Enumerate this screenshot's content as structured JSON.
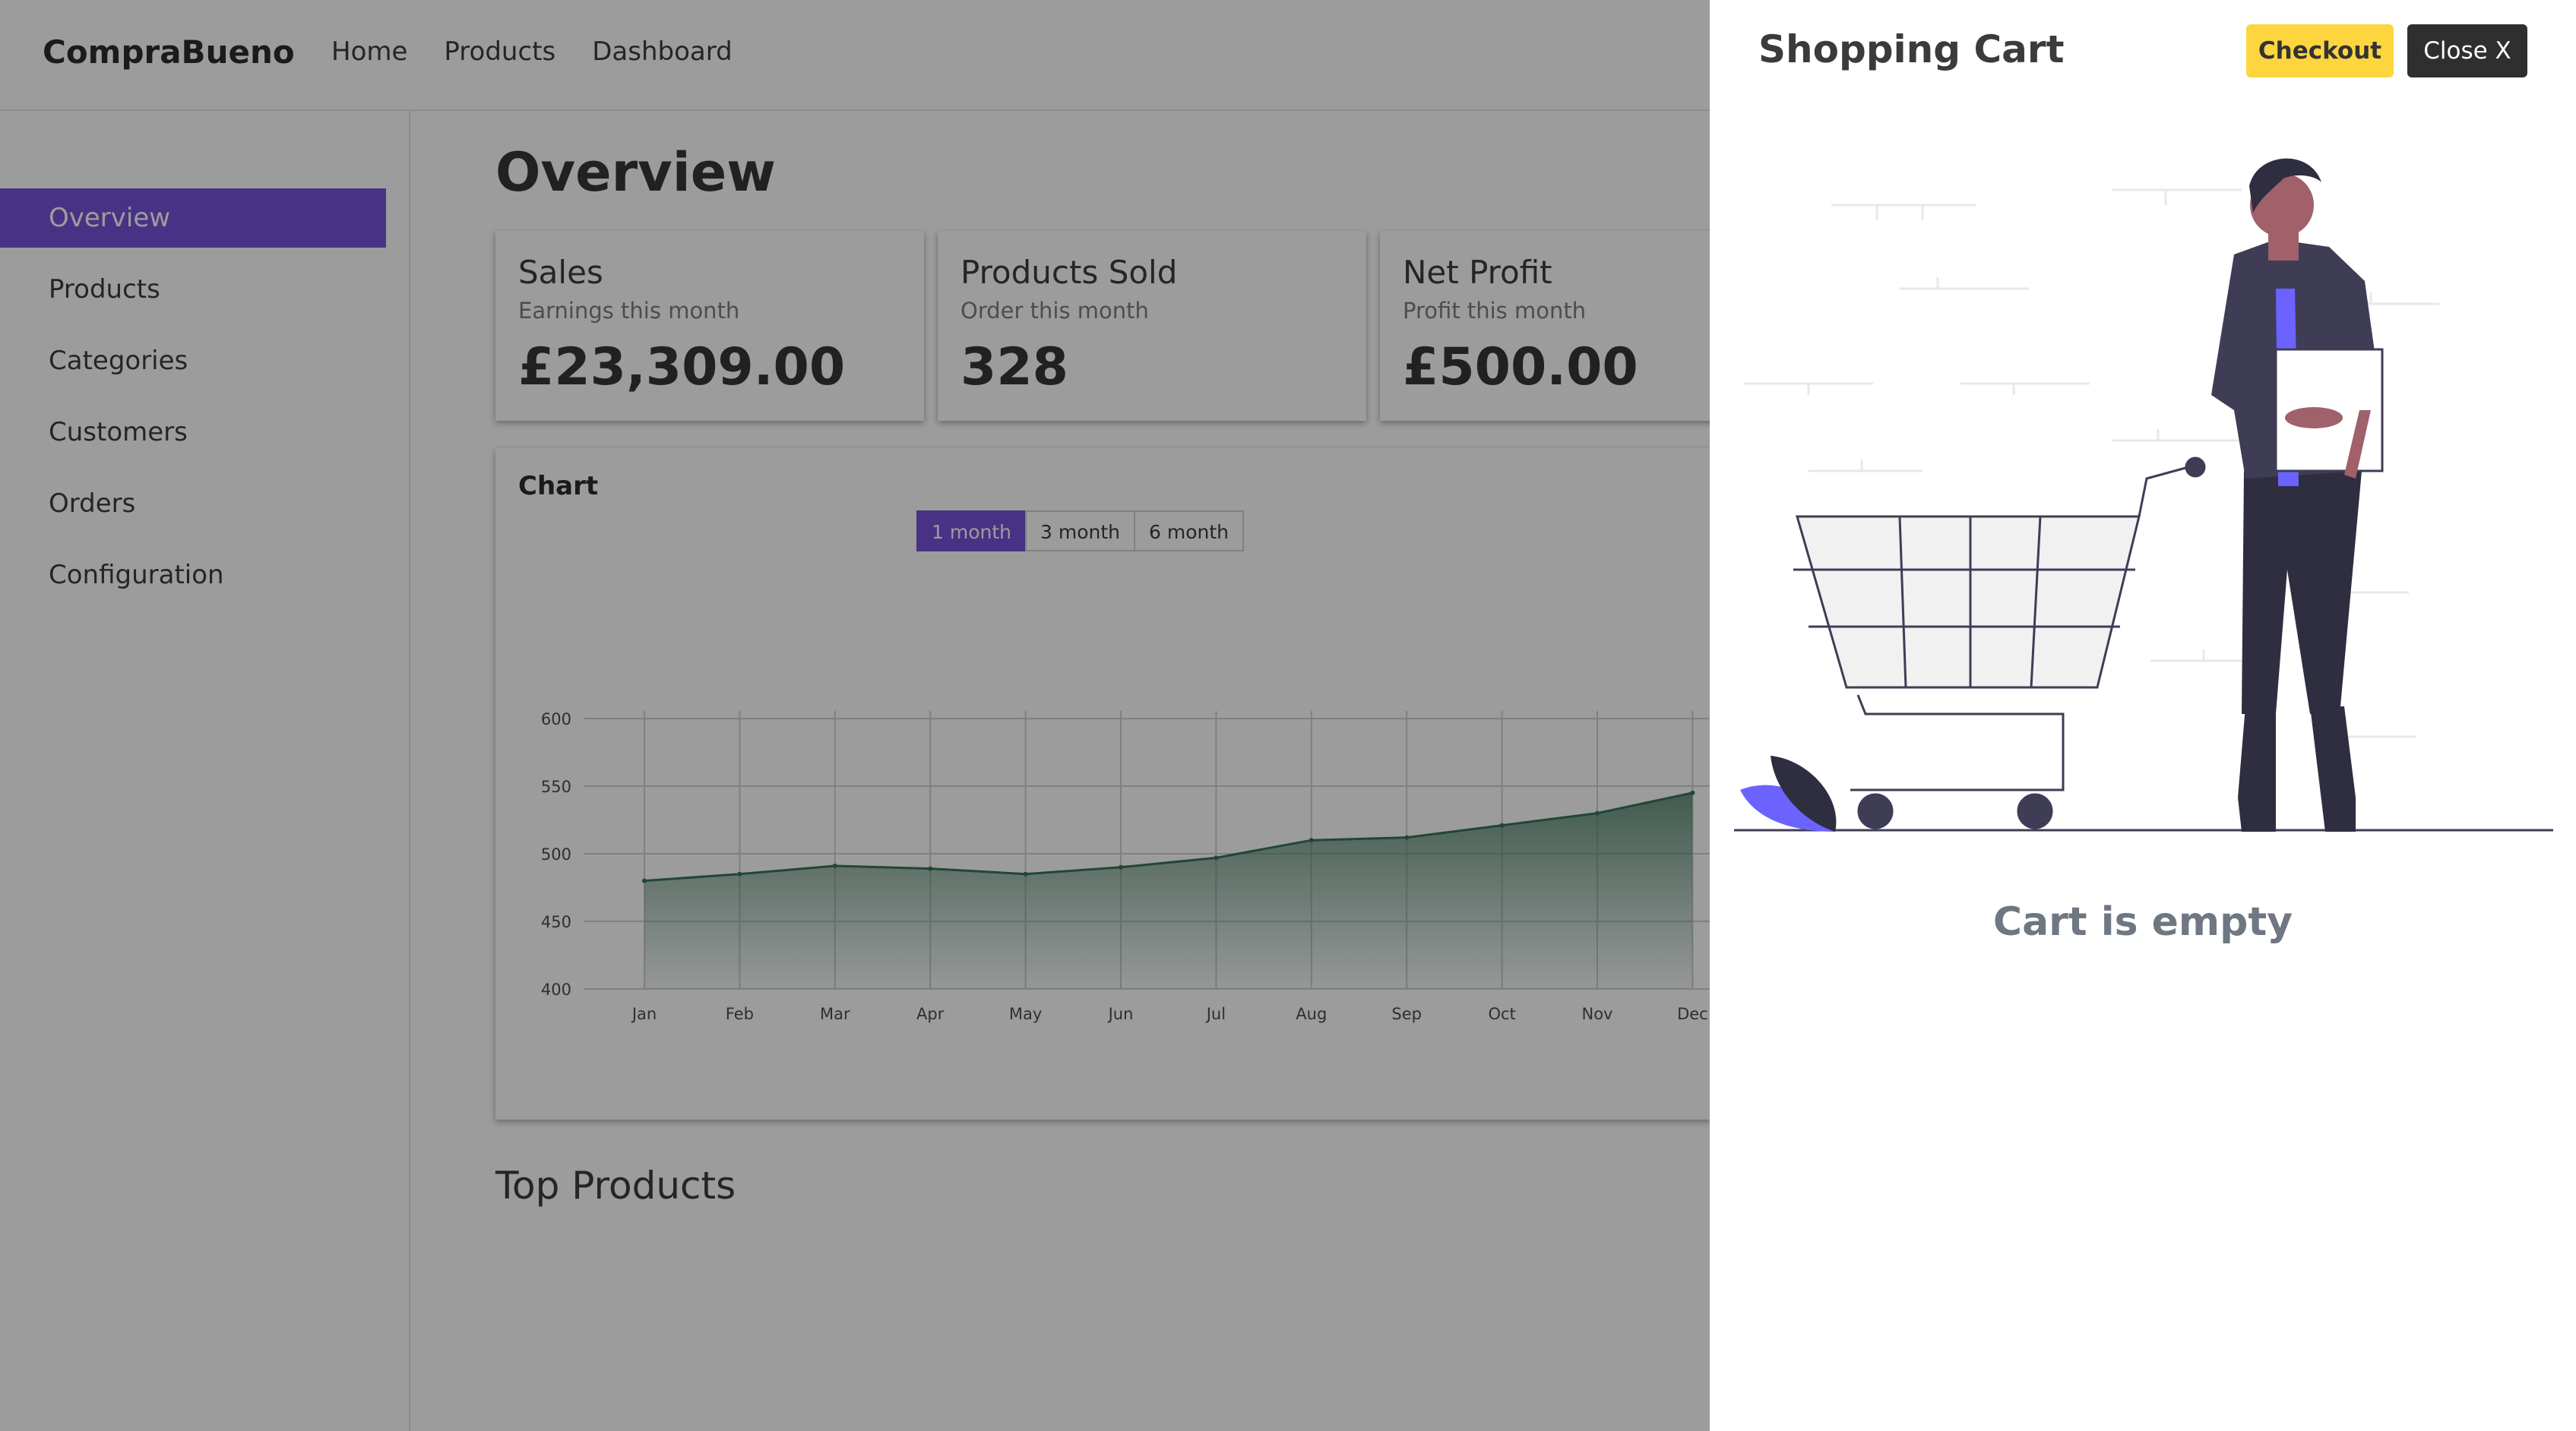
{
  "app": {
    "brand": "CompraBueno",
    "nav": [
      "Home",
      "Products",
      "Dashboard"
    ]
  },
  "sidebar": {
    "items": [
      {
        "label": "Overview",
        "active": true
      },
      {
        "label": "Products",
        "active": false
      },
      {
        "label": "Categories",
        "active": false
      },
      {
        "label": "Customers",
        "active": false
      },
      {
        "label": "Orders",
        "active": false
      },
      {
        "label": "Configuration",
        "active": false
      }
    ]
  },
  "main": {
    "title": "Overview",
    "cards": [
      {
        "title": "Sales",
        "subtitle": "Earnings this month",
        "value": "£23,309.00"
      },
      {
        "title": "Products Sold",
        "subtitle": "Order this month",
        "value": "328"
      },
      {
        "title": "Net Profit",
        "subtitle": "Profit this month",
        "value": "£500.00"
      }
    ],
    "chart_section": {
      "heading": "Chart",
      "ranges": [
        {
          "label": "1 month",
          "active": true
        },
        {
          "label": "3 month",
          "active": false
        },
        {
          "label": "6 month",
          "active": false
        }
      ]
    },
    "top_products_heading": "Top Products"
  },
  "chart_data": {
    "type": "area",
    "title": "",
    "categories": [
      "Jan",
      "Feb",
      "Mar",
      "Apr",
      "May",
      "Jun",
      "Jul",
      "Aug",
      "Sep",
      "Oct",
      "Nov",
      "Dec"
    ],
    "series": [
      {
        "values": [
          480,
          485,
          491,
          489,
          485,
          490,
          497,
          510,
          512,
          521,
          530,
          545
        ]
      }
    ],
    "ylim": [
      400,
      600
    ],
    "yticks": [
      400,
      450,
      500,
      550,
      600
    ],
    "grid": true,
    "color": "#2e6b4f"
  },
  "cart": {
    "title": "Shopping Cart",
    "checkout_label": "Checkout",
    "close_label": "Close X",
    "empty_message": "Cart is empty"
  },
  "colors": {
    "accent": "#6f49d8",
    "checkout": "#fdd53f",
    "chart_line": "#2e6b4f"
  }
}
